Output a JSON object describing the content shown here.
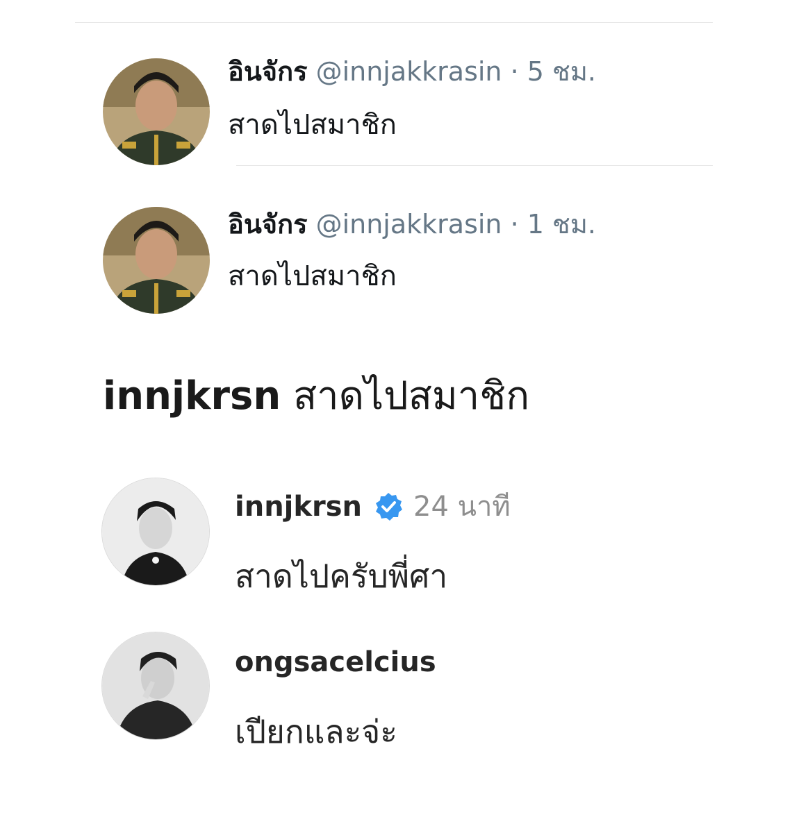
{
  "twitter": {
    "tweets": [
      {
        "name": "อินจักร",
        "handle": "@innjakkrasin",
        "separator": "·",
        "time": "5 ชม.",
        "text": "สาดไปสมาชิก",
        "avatar_icon": "avatar-uniform-photo"
      },
      {
        "name": "อินจักร",
        "handle": "@innjakkrasin",
        "separator": "·",
        "time": "1 ชม.",
        "text": "สาดไปสมาชิก",
        "avatar_icon": "avatar-uniform-photo"
      }
    ]
  },
  "instagram": {
    "caption": {
      "user": "innjkrsn",
      "text": "สาดไปสมาชิก"
    },
    "comments": [
      {
        "user": "innjkrsn",
        "verified": true,
        "time": "24 นาที",
        "text": "สาดไปครับพี่ศา",
        "avatar_icon": "avatar-bw-portrait"
      },
      {
        "user": "ongsacelcius",
        "verified": false,
        "time": "",
        "text": "เปียกและจ่ะ",
        "avatar_icon": "avatar-bw-portrait"
      }
    ]
  },
  "colors": {
    "twitter_text": "#14171a",
    "twitter_secondary": "#657786",
    "instagram_text": "#262626",
    "instagram_secondary": "#8e8e8e",
    "verified_blue": "#3897f0"
  }
}
